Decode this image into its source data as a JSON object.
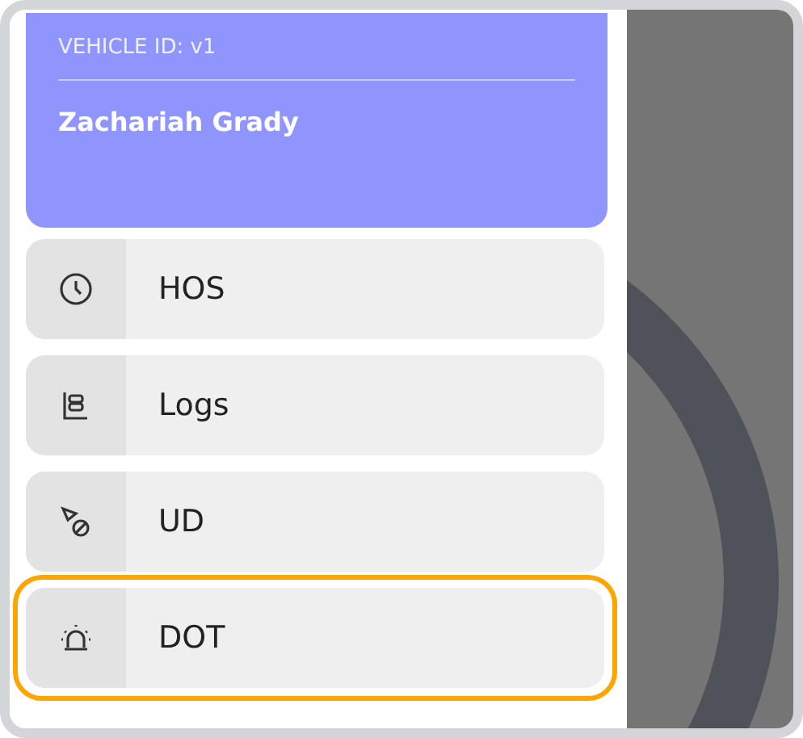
{
  "vehicle_card": {
    "vehicle_id": "VEHICLE ID: v1",
    "driver_name": "Zachariah Grady"
  },
  "menu": [
    {
      "kind": "clock",
      "label": "HOS",
      "selected": false
    },
    {
      "kind": "logs",
      "label": "Logs",
      "selected": false
    },
    {
      "kind": "ud",
      "label": "UD",
      "selected": false
    },
    {
      "kind": "alarm",
      "label": "DOT",
      "selected": true
    }
  ]
}
